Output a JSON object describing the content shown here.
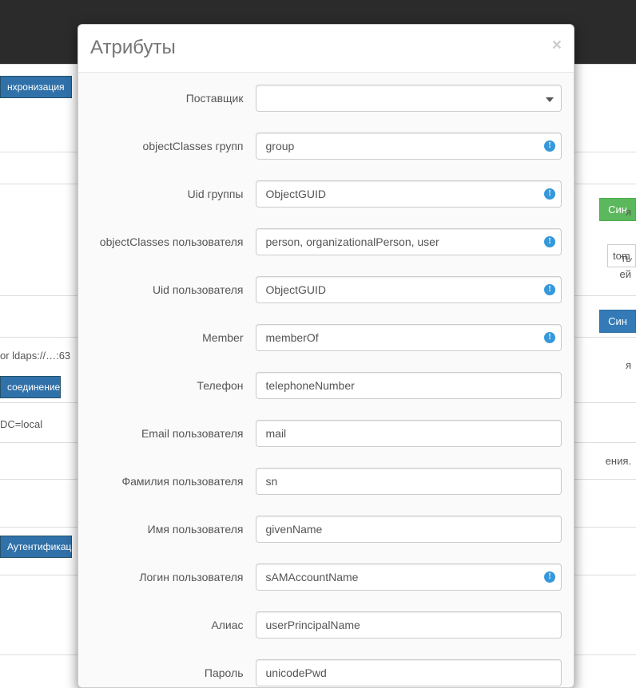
{
  "background": {
    "tabs": {
      "sync": "нхронизация",
      "conn": "соединение",
      "auth": "Аутентификаци"
    },
    "urlHint": "or ldaps://…:63",
    "dcHint": "DC=local",
    "rightSideYa": "я",
    "rightSideT": "ть",
    "rightSideEi": "ей",
    "rightSideYa2": "я",
    "rightSideEniya": "ения.",
    "greenBtn": "Син",
    "blueBtn": "Син",
    "tom": "tom."
  },
  "modal": {
    "title": "Атрибуты",
    "fields": {
      "provider": {
        "label": "Поставщик",
        "value": "",
        "info": false,
        "type": "select"
      },
      "groupObjClass": {
        "label": "objectClasses групп",
        "value": "group",
        "info": true
      },
      "groupUid": {
        "label": "Uid группы",
        "value": "ObjectGUID",
        "info": true
      },
      "userObjClass": {
        "label": "objectClasses пользователя",
        "value": "person, organizationalPerson, user",
        "info": true
      },
      "userUid": {
        "label": "Uid пользователя",
        "value": "ObjectGUID",
        "info": true
      },
      "member": {
        "label": "Member",
        "value": "memberOf",
        "info": true
      },
      "phone": {
        "label": "Телефон",
        "value": "telephoneNumber",
        "info": false
      },
      "email": {
        "label": "Email пользователя",
        "value": "mail",
        "info": false
      },
      "lastName": {
        "label": "Фамилия пользователя",
        "value": "sn",
        "info": false
      },
      "firstName": {
        "label": "Имя пользователя",
        "value": "givenName",
        "info": false
      },
      "login": {
        "label": "Логин пользователя",
        "value": "sAMAccountName",
        "info": true
      },
      "alias": {
        "label": "Алиас",
        "value": "userPrincipalName",
        "info": false
      },
      "password": {
        "label": "Пароль",
        "value": "unicodePwd",
        "info": false
      }
    }
  }
}
